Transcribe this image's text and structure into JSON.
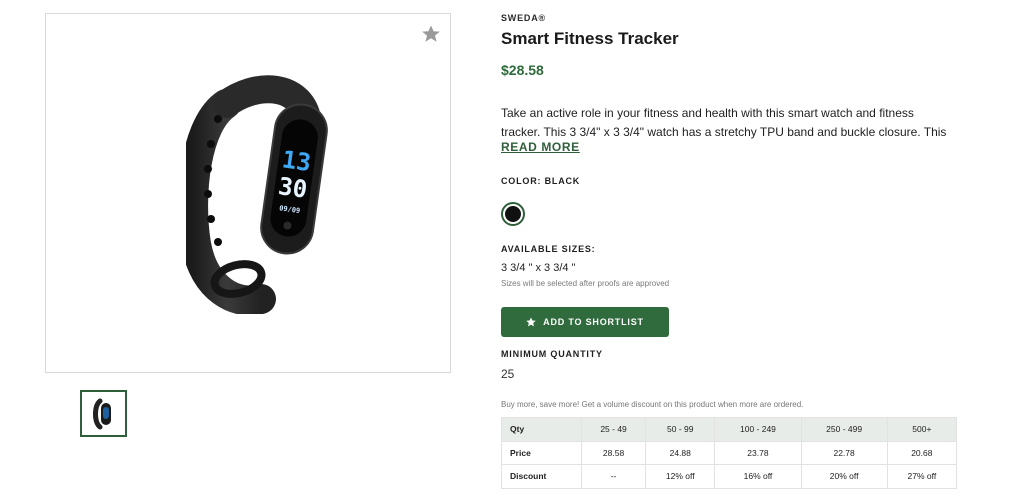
{
  "brand": "SWEDA®",
  "title": "Smart Fitness Tracker",
  "price": "$28.58",
  "description": {
    "line1": "Take an active role in your fitness and health with this smart watch and fitness",
    "line2": "tracker. This 3 3/4\" x 3 3/4\" watch has a stretchy TPU band and buckle closure. This"
  },
  "read_more": "READ MORE",
  "color": {
    "label": "COLOR: BLACK",
    "swatch_hex": "#111111"
  },
  "sizes": {
    "label": "AVAILABLE SIZES:",
    "value": "3 3/4 \" x 3 3/4 \"",
    "note": "Sizes will be selected after proofs are approved"
  },
  "shortlist_button": "ADD TO SHORTLIST",
  "minimum_quantity": {
    "label": "MINIMUM QUANTITY",
    "value": "25"
  },
  "promo_text": "Buy more, save more! Get a volume discount on this product when more are ordered.",
  "pricing_table": {
    "headers": [
      "Qty",
      "25 - 49",
      "50 - 99",
      "100 - 249",
      "250 - 499",
      "500+"
    ],
    "price_row": [
      "Price",
      "28.58",
      "24.88",
      "23.78",
      "22.78",
      "20.68"
    ],
    "discount_row": [
      "Discount",
      "--",
      "12% off",
      "16% off",
      "20% off",
      "27% off"
    ]
  },
  "watch_display": {
    "hour": "13",
    "minute": "30",
    "date": "09/09"
  },
  "colors": {
    "accent_green": "#2f6b3c",
    "price_green": "#2f6b3c",
    "table_header_bg": "#e8ece8"
  }
}
